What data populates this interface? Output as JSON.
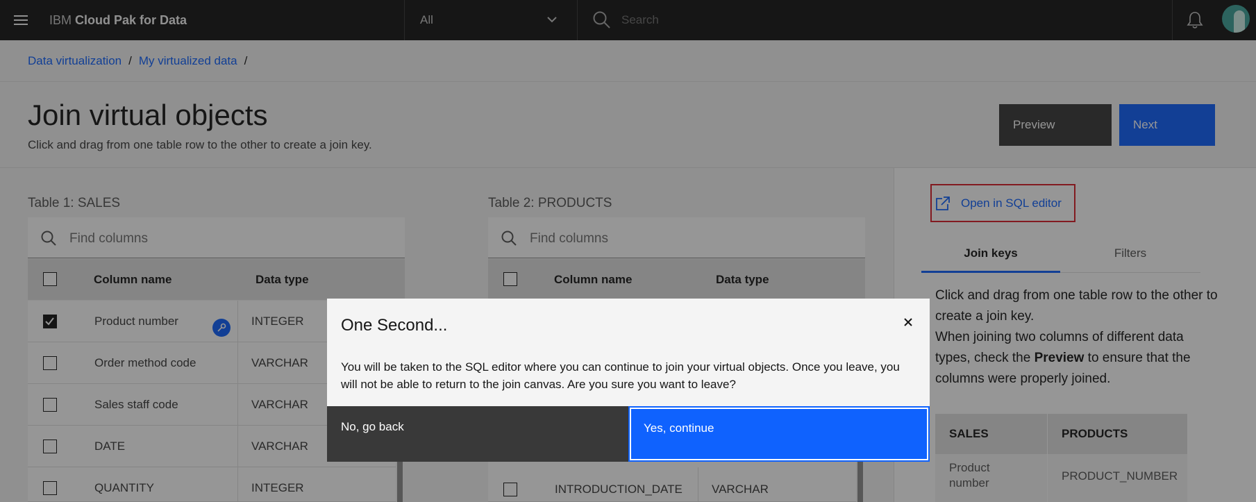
{
  "header": {
    "brand_prefix": "IBM",
    "brand_name": "Cloud Pak for Data",
    "scope": "All",
    "search_placeholder": "Search"
  },
  "breadcrumb": [
    "Data virtualization",
    "My virtualized data"
  ],
  "page": {
    "title": "Join virtual objects",
    "subtitle": "Click and drag from one table row to the other to create a join key.",
    "preview_label": "Preview",
    "next_label": "Next"
  },
  "table1": {
    "label": "Table 1: SALES",
    "find_placeholder": "Find columns",
    "col_name_header": "Column name",
    "data_type_header": "Data type",
    "rows": [
      {
        "name": "Product number",
        "type": "INTEGER",
        "checked": true
      },
      {
        "name": "Order method code",
        "type": "VARCHAR",
        "checked": false
      },
      {
        "name": "Sales staff code",
        "type": "VARCHAR",
        "checked": false
      },
      {
        "name": "DATE",
        "type": "VARCHAR",
        "checked": false
      },
      {
        "name": "QUANTITY",
        "type": "INTEGER",
        "checked": false
      }
    ]
  },
  "table2": {
    "label": "Table 2: PRODUCTS",
    "find_placeholder": "Find columns",
    "col_name_header": "Column name",
    "data_type_header": "Data type",
    "rows": [
      {
        "name": "INTRODUCTION_DATE",
        "type": "VARCHAR",
        "checked": false
      }
    ]
  },
  "side": {
    "sql_link": "Open in SQL editor",
    "tab_join": "Join keys",
    "tab_filters": "Filters",
    "help_1": "Click and drag from one table row to the other to create a join key.",
    "help_2a": "When joining two columns of different data types, check the ",
    "help_2b": "Preview",
    "help_2c": " to ensure that the columns were properly joined.",
    "join_header_1": "SALES",
    "join_header_2": "PRODUCTS",
    "join_val_1": "Product number",
    "join_val_2": "PRODUCT_NUMBER"
  },
  "modal": {
    "title": "One Second...",
    "body": "You will be taken to the SQL editor where you can continue to join your virtual objects. Once you leave, you will not be able to return to the join canvas. Are you sure you want to leave?",
    "no_label": "No, go back",
    "yes_label": "Yes, continue"
  },
  "colors": {
    "accent": "#0f62fe",
    "header": "#161616",
    "highlight": "#da1e28"
  }
}
